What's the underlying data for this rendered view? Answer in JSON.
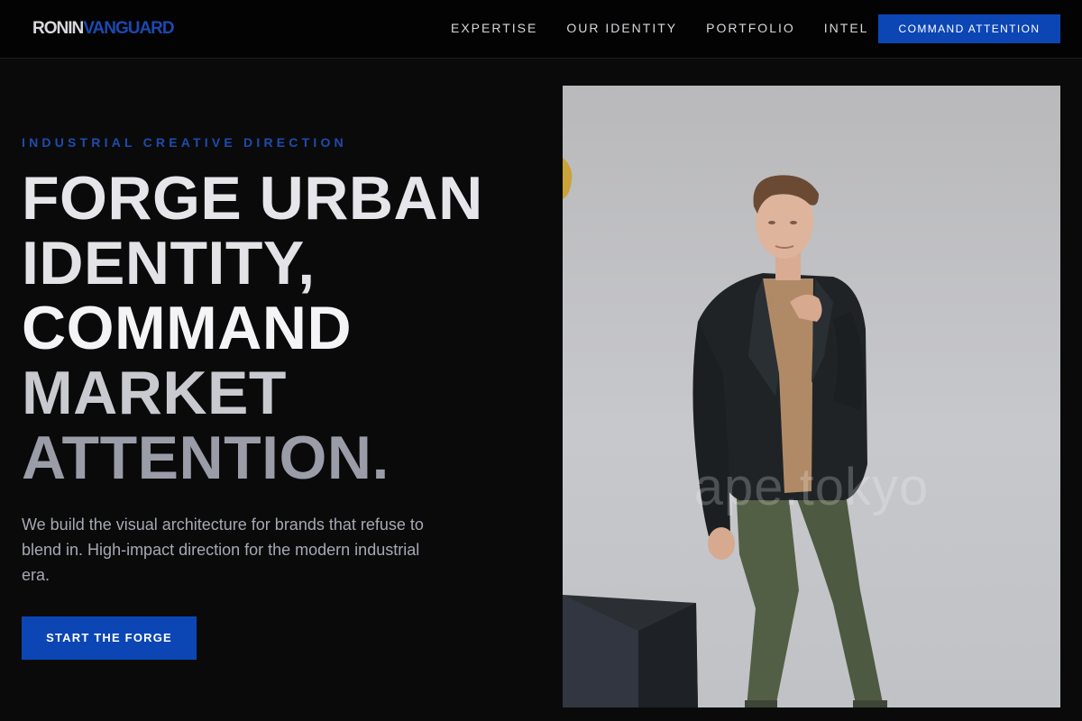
{
  "brand": {
    "name_primary": "RONIN",
    "name_secondary": "VANGUARD"
  },
  "nav": {
    "links": [
      "EXPERTISE",
      "OUR IDENTITY",
      "PORTFOLIO",
      "INTEL"
    ],
    "cta_label": "COMMAND ATTENTION"
  },
  "hero": {
    "eyebrow": "INDUSTRIAL CREATIVE DIRECTION",
    "headline_lines": [
      "FORGE URBAN",
      "IDENTITY,",
      "COMMAND",
      "MARKET",
      "ATTENTION."
    ],
    "lead": "We build the visual architecture for brands that refuse to blend in. High-impact direction for the modern industrial era.",
    "cta_label": "START THE FORGE",
    "image": {
      "watermark": "ape.tokyo"
    }
  },
  "colors": {
    "accent": "#0c46b4",
    "background": "#0a0a0b",
    "nav_background": "#030304",
    "eyebrow": "#1e4cae"
  }
}
